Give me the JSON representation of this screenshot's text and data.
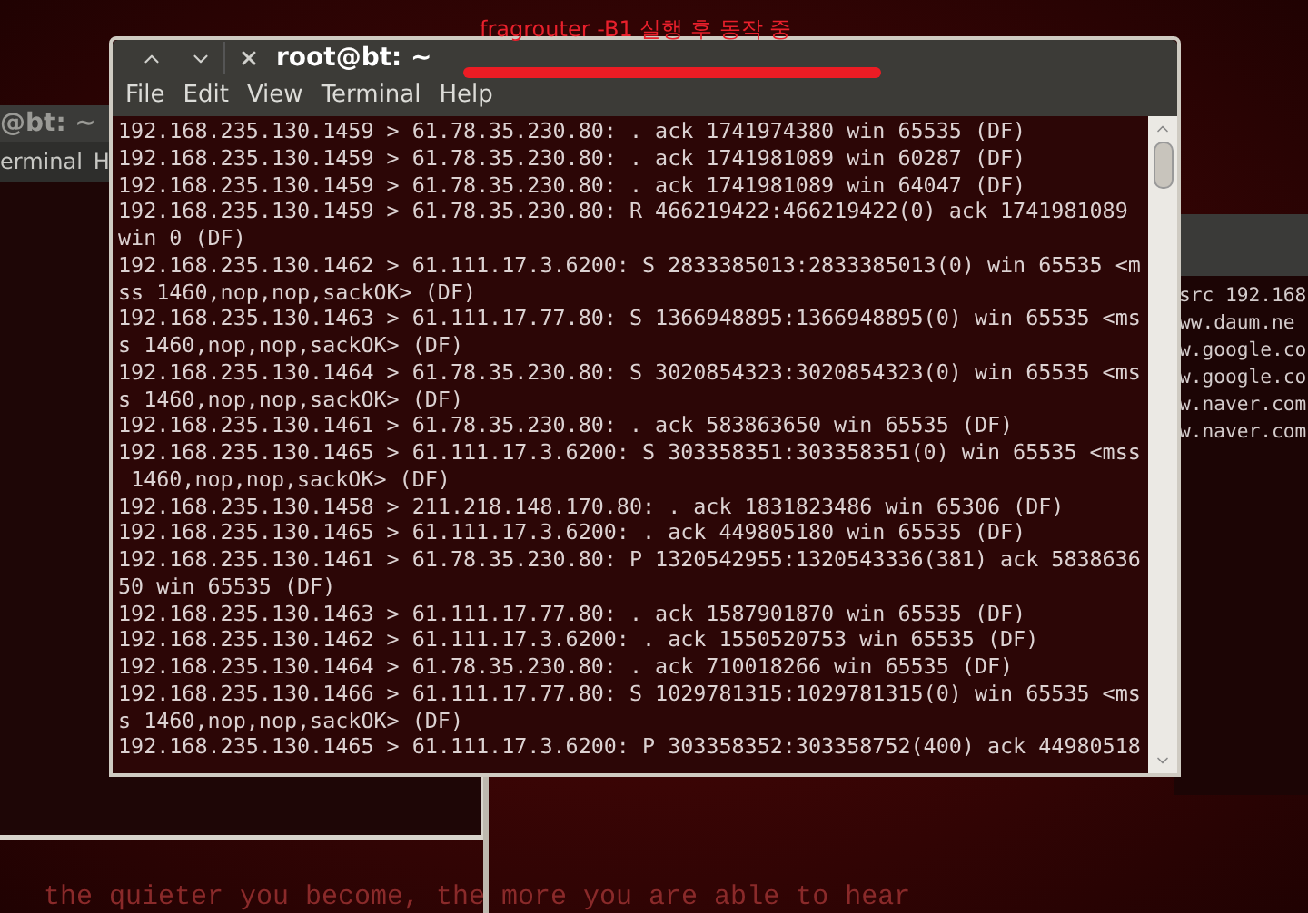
{
  "wallpaper": {
    "tagline": "the quieter you become, the more you are able to hear"
  },
  "background_windows": [
    {
      "kind": "left",
      "title": "@bt: ~",
      "menu": [
        "erminal",
        "H"
      ]
    },
    {
      "kind": "right",
      "lines": [
        "src 192.168",
        "ww.daum.ne",
        "w.google.co",
        "w.google.co",
        "w.naver.com",
        "w.naver.com"
      ]
    }
  ],
  "window": {
    "title": "root@bt: ~",
    "menu": [
      "File",
      "Edit",
      "View",
      "Terminal",
      "Help"
    ],
    "lines": [
      "192.168.235.130.1459 > 61.78.35.230.80: . ack 1741974380 win 65535 (DF)",
      "192.168.235.130.1459 > 61.78.35.230.80: . ack 1741981089 win 60287 (DF)",
      "192.168.235.130.1459 > 61.78.35.230.80: . ack 1741981089 win 64047 (DF)",
      "192.168.235.130.1459 > 61.78.35.230.80: R 466219422:466219422(0) ack 1741981089",
      "win 0 (DF)",
      "192.168.235.130.1462 > 61.111.17.3.6200: S 2833385013:2833385013(0) win 65535 <m",
      "ss 1460,nop,nop,sackOK> (DF)",
      "192.168.235.130.1463 > 61.111.17.77.80: S 1366948895:1366948895(0) win 65535 <ms",
      "s 1460,nop,nop,sackOK> (DF)",
      "192.168.235.130.1464 > 61.78.35.230.80: S 3020854323:3020854323(0) win 65535 <ms",
      "s 1460,nop,nop,sackOK> (DF)",
      "192.168.235.130.1461 > 61.78.35.230.80: . ack 583863650 win 65535 (DF)",
      "192.168.235.130.1465 > 61.111.17.3.6200: S 303358351:303358351(0) win 65535 <mss",
      " 1460,nop,nop,sackOK> (DF)",
      "192.168.235.130.1458 > 211.218.148.170.80: . ack 1831823486 win 65306 (DF)",
      "192.168.235.130.1465 > 61.111.17.3.6200: . ack 449805180 win 65535 (DF)",
      "192.168.235.130.1461 > 61.78.35.230.80: P 1320542955:1320543336(381) ack 5838636",
      "50 win 65535 (DF)",
      "192.168.235.130.1463 > 61.111.17.77.80: . ack 1587901870 win 65535 (DF)",
      "192.168.235.130.1462 > 61.111.17.3.6200: . ack 1550520753 win 65535 (DF)",
      "192.168.235.130.1464 > 61.78.35.230.80: . ack 710018266 win 65535 (DF)",
      "192.168.235.130.1466 > 61.111.17.77.80: S 1029781315:1029781315(0) win 65535 <ms",
      "s 1460,nop,nop,sackOK> (DF)",
      "192.168.235.130.1465 > 61.111.17.3.6200: P 303358352:303358752(400) ack 44980518"
    ]
  },
  "annotation": {
    "text": "fragrouter -B1 실행 후 동작 중"
  }
}
